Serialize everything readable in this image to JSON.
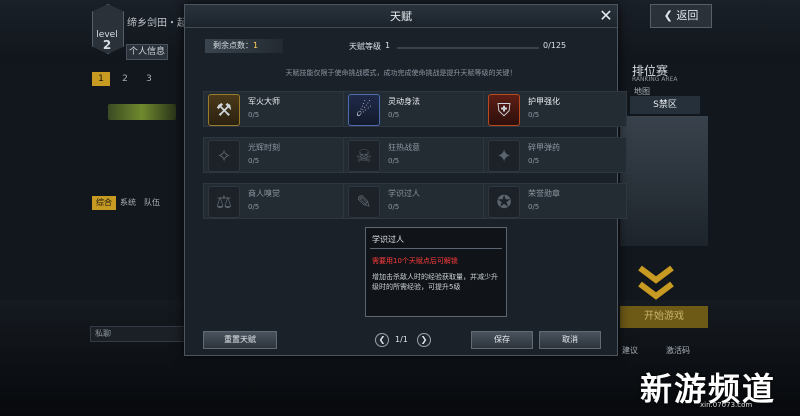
{
  "background": {
    "player_name": "缔乡剑田・起",
    "level_label": "level",
    "level_num": "2",
    "info_btn": "个人信息",
    "num_tabs": [
      "1",
      "2",
      "3"
    ],
    "bottom_tabs": [
      "综合",
      "系统",
      "队伍"
    ],
    "chat_placeholder": "私聊",
    "back_btn": "返回",
    "rank_title": "排位赛",
    "rank_sub": "RANKING AREA",
    "map_label": "地图",
    "map_area": "S禁区",
    "start_btn": "开始游戏",
    "link_suggest": "建议",
    "link_mail": "激活码"
  },
  "watermark": {
    "main": "新游频道",
    "sub": "xin.07073.com"
  },
  "modal": {
    "title": "天赋",
    "points_label": "剩余点数：",
    "points_value": "1",
    "level_label": "天赋等级",
    "level_value": "1",
    "level_max": "0/125",
    "level_progress": 0,
    "description": "天赋技能仅限于使命挑战模式，成功完成使命挑战是提升天赋等级的关键！",
    "talents": [
      {
        "name": "军火大师",
        "progress": "0/5",
        "icon": "ammo-icon",
        "active": true,
        "glyph": "⚒",
        "style": "on"
      },
      {
        "name": "灵动身法",
        "progress": "0/5",
        "icon": "agility-icon",
        "active": true,
        "glyph": "☄",
        "style": "on-blue"
      },
      {
        "name": "护甲强化",
        "progress": "0/5",
        "icon": "armor-icon",
        "active": true,
        "glyph": "⛨",
        "style": "on-red"
      },
      {
        "name": "光辉时刻",
        "progress": "0/5",
        "icon": "glory-icon",
        "active": false,
        "glyph": "✧",
        "style": "off"
      },
      {
        "name": "狂热战意",
        "progress": "0/5",
        "icon": "fervor-icon",
        "active": false,
        "glyph": "☠",
        "style": "off"
      },
      {
        "name": "碎甲弹药",
        "progress": "0/5",
        "icon": "piercing-ammo-icon",
        "active": false,
        "glyph": "✦",
        "style": "off"
      },
      {
        "name": "商人嗅觉",
        "progress": "0/5",
        "icon": "merchant-icon",
        "active": false,
        "glyph": "⚖",
        "style": "off"
      },
      {
        "name": "学识过人",
        "progress": "0/5",
        "icon": "knowledge-icon",
        "active": false,
        "glyph": "✎",
        "style": "off"
      },
      {
        "name": "荣誉勋章",
        "progress": "0/5",
        "icon": "medal-icon",
        "active": false,
        "glyph": "✪",
        "style": "off"
      }
    ],
    "tooltip": {
      "title": "学识过人",
      "requirement": "需要用10个天赋点后可解锁",
      "body": "增加击杀敌人时的经验获取量，并减少升级时的所需经验，可提升5级"
    },
    "reset_btn": "重置天赋",
    "page": "1/1",
    "save_btn": "保存",
    "cancel_btn": "取消",
    "colors": {
      "gold": "#c79a22",
      "warn": "#ff3b3b"
    }
  }
}
